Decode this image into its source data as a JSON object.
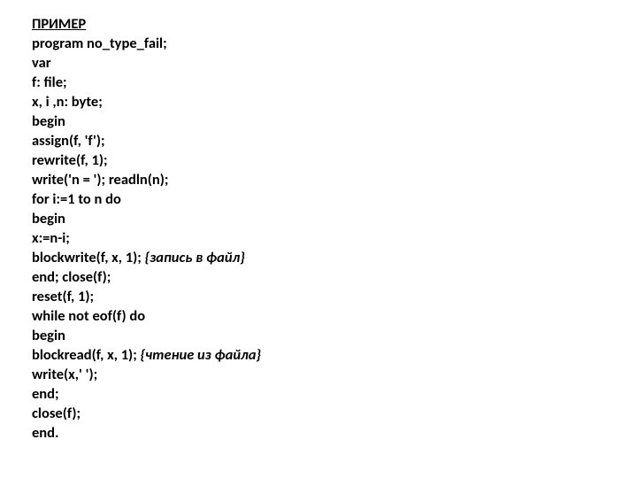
{
  "code": {
    "title": "ПРИМЕР",
    "l1": "program no_type_fail;",
    "l2": "var",
    "l3": "f: file;",
    "l4": "x, i ,n: byte;",
    "l5": "begin",
    "l6": "assign(f, 'f');",
    "l7": "rewrite(f, 1);",
    "l8": "write('n = '); readln(n);",
    "l9": "for i:=1 to n do",
    "l10": "begin",
    "l11": "x:=n-i;",
    "l12a": "blockwrite(f, x, 1); ",
    "l12b": "{запись в файл}",
    "l13": "end; close(f);",
    "l14": "reset(f, 1);",
    "l15": "while not eof(f) do",
    "l16": "begin",
    "l17a": "blockread(f, x, 1); ",
    "l17b": "{чтение из файла}",
    "l18": "write(x,' ');",
    "l19": "end;",
    "l20": "close(f);",
    "l21": "end."
  }
}
